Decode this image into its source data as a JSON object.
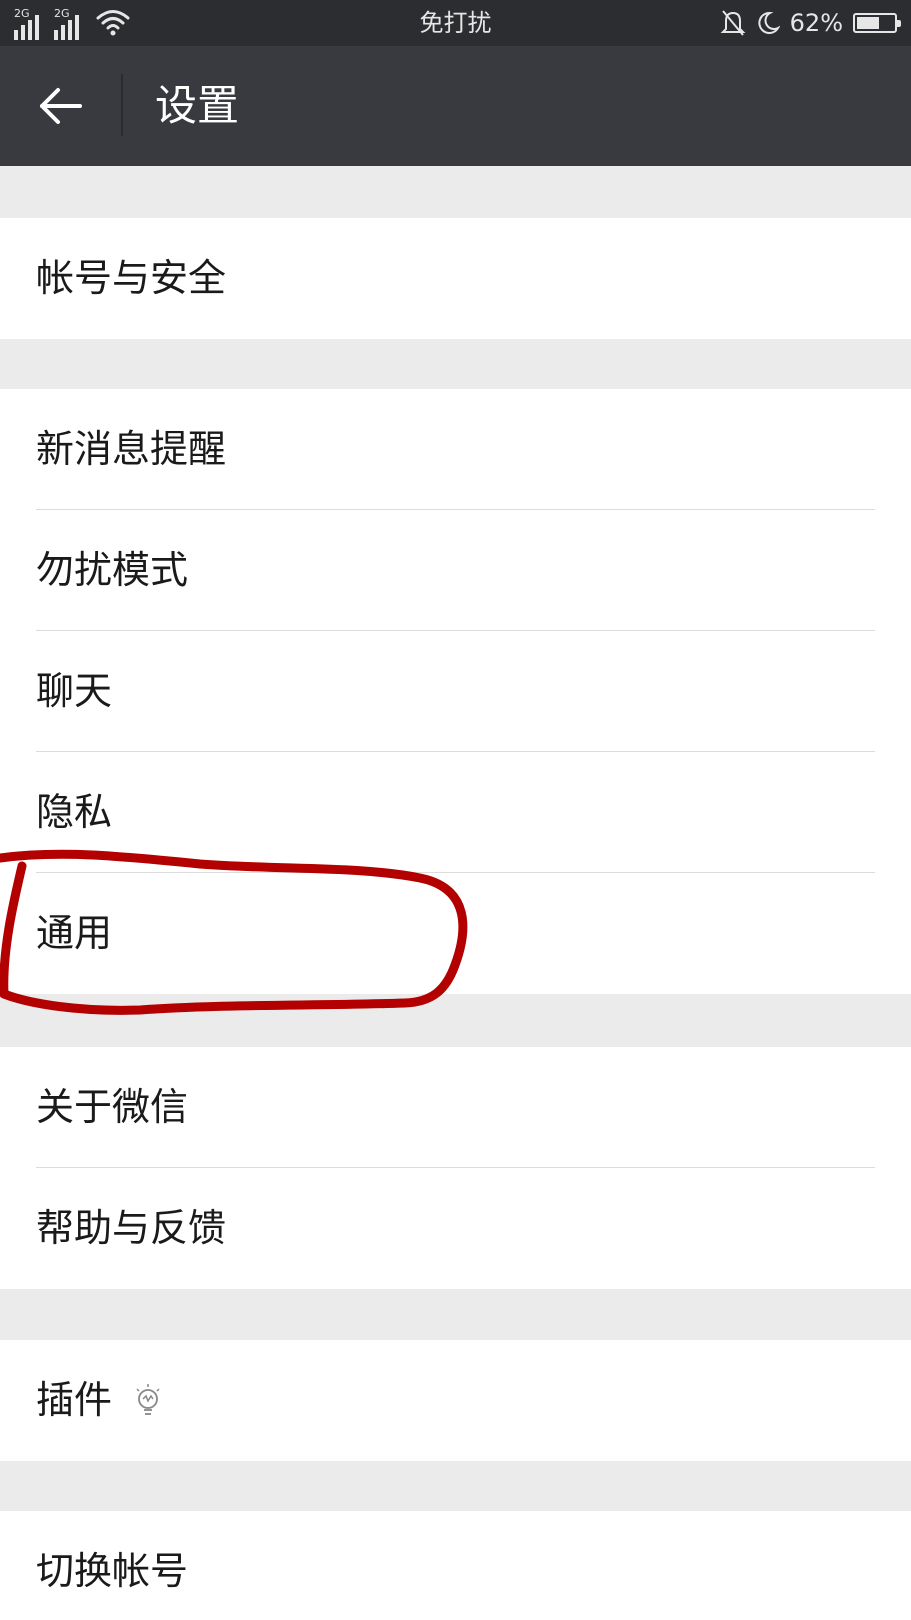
{
  "status_bar": {
    "signal_1": "2G",
    "signal_2": "2G",
    "center_text": "免打扰",
    "battery_text": "62%",
    "battery_level": 0.62,
    "icons": [
      "signal-icon",
      "signal-icon",
      "wifi-icon",
      "bell-muted-icon",
      "moon-icon",
      "battery-icon"
    ]
  },
  "header": {
    "back_icon": "arrow-left-icon",
    "title": "设置"
  },
  "groups": [
    {
      "items": [
        {
          "label": "帐号与安全"
        }
      ]
    },
    {
      "items": [
        {
          "label": "新消息提醒"
        },
        {
          "label": "勿扰模式"
        },
        {
          "label": "聊天"
        },
        {
          "label": "隐私"
        },
        {
          "label": "通用",
          "annotated": true
        }
      ]
    },
    {
      "items": [
        {
          "label": "关于微信"
        },
        {
          "label": "帮助与反馈"
        }
      ]
    },
    {
      "items": [
        {
          "label": "插件",
          "icon": "lightbulb-icon"
        }
      ]
    },
    {
      "items": [
        {
          "label": "切换帐号"
        }
      ]
    }
  ],
  "colors": {
    "status_bar_bg": "#2c2d30",
    "title_bar_bg": "#393a3f",
    "page_bg": "#ebebeb",
    "annotation_red": "#b30000"
  }
}
